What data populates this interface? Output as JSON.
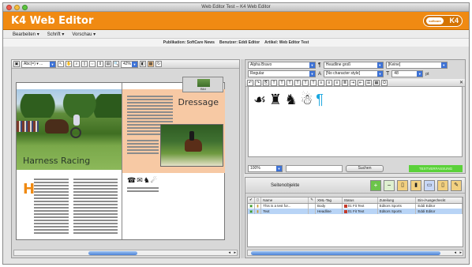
{
  "window": {
    "title": "Web Editor Test – K4 Web Editor"
  },
  "app": {
    "title": "K4 Web Editor",
    "logo_small": "softcare",
    "logo_big": "K4"
  },
  "menu": [
    "Bearbeiten ▾",
    "Schrift ▾",
    "Vorschau ▾"
  ],
  "info": {
    "publication": "Publikation: SoftCare News",
    "user": "Benutzer: Eddi Editor",
    "article": "Artikel: Web Editor Test"
  },
  "left_toolbar": {
    "zoom": "42%",
    "view_select": "Abc(=) ▾ ..."
  },
  "page": {
    "heading_right": "Dressage",
    "heading_left": "Harness Racing",
    "drop_cap": "H",
    "thumb_label": "Bild"
  },
  "right_toolbar": {
    "font": "Alpha Bravo",
    "style": "Regular",
    "para_style": "Headline groß",
    "char_style": "[No character style]",
    "color": "[Keine]",
    "size": "48",
    "unit": "pt"
  },
  "glyph_panel": {
    "zoom": "100%",
    "search_placeholder": "",
    "search_button": "Suchen",
    "status": "TEXTVERFASSUNG"
  },
  "objects": {
    "tab": "Seitenobjekte",
    "columns": [
      "Name",
      "XML-Tag",
      "Status",
      "Zuteilung",
      "Ein-/Ausgecheckt"
    ],
    "rows": [
      {
        "name": "This is a test for...",
        "tag": "Body",
        "status": "01 Fit Text",
        "assign": "Editors Sports",
        "checked": "Eddi Editor"
      },
      {
        "name": "Text",
        "tag": "Headline",
        "status": "01 Fit Text",
        "assign": "Editors Sports",
        "checked": "Eddi Editor"
      }
    ]
  },
  "colors": {
    "header": "#f08a12",
    "accent_blue": "#3d72d6",
    "status_green": "#5bd13a"
  }
}
